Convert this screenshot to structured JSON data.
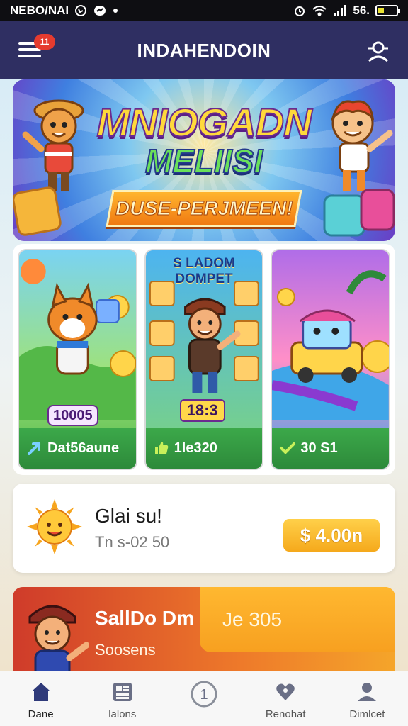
{
  "status_bar": {
    "carrier": "NEBO/NAI",
    "battery": "56."
  },
  "header": {
    "title": "INDAHENDOIN",
    "notification_count": "11"
  },
  "hero": {
    "title": "MNIOGADN",
    "subtitle": "MELIISI",
    "ribbon": "DUSE-PERJMEEN!"
  },
  "game_cards": [
    {
      "badge": "10005",
      "footer_label": "Dat56aune",
      "footer_icon": "arrow-icon"
    },
    {
      "title_line1": "S LADOM",
      "title_line2": "DOMPET",
      "value": "18:3",
      "footer_label": "1le320",
      "footer_icon": "thumbs-up-icon"
    },
    {
      "footer_label": "30 S1",
      "footer_icon": "check-icon"
    }
  ],
  "greeting": {
    "title": "Glai su!",
    "subtitle": "Tn s-02 50",
    "button_label": "$ 4.00n"
  },
  "promo": {
    "title": "SallDo Dm",
    "subtitle": "Soosens",
    "value": "Je 305"
  },
  "bottom_nav": [
    {
      "label": "Dane",
      "icon": "home-icon"
    },
    {
      "label": "lalons",
      "icon": "grid-icon"
    },
    {
      "label": "",
      "icon": "coin-icon"
    },
    {
      "label": "Renohat",
      "icon": "heart-icon"
    },
    {
      "label": "Dimlcet",
      "icon": "user-icon"
    }
  ],
  "colors": {
    "header_bg": "#2f2f62",
    "accent_orange": "#f5a91c",
    "card_green": "#3ca94a",
    "badge_red": "#e53b2f"
  }
}
